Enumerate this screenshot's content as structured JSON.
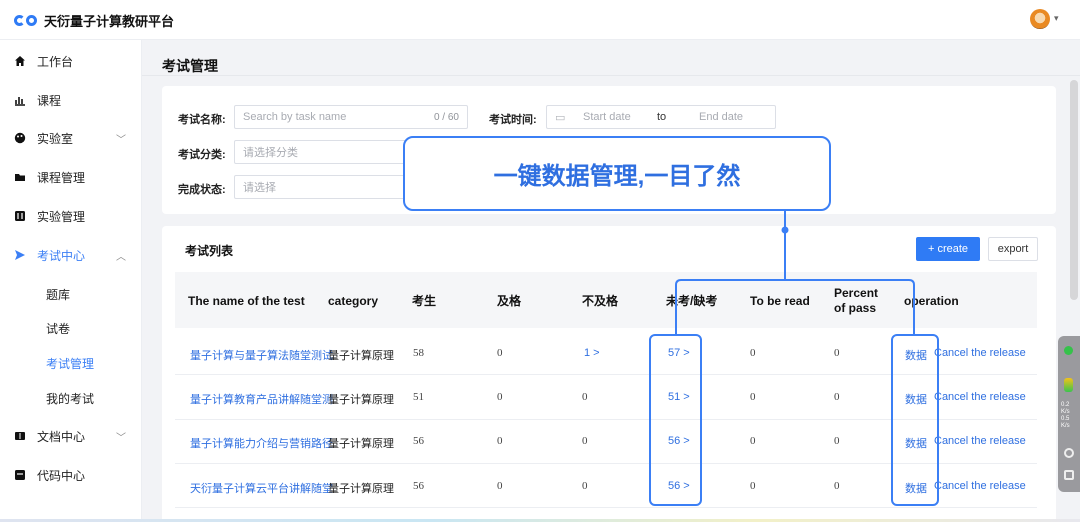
{
  "app": {
    "title": "天衍量子计算教研平台"
  },
  "sidebar": {
    "items": [
      {
        "label": "工作台",
        "icon": "home-icon"
      },
      {
        "label": "课程",
        "icon": "chart-icon"
      },
      {
        "label": "实验室",
        "icon": "palette-icon"
      },
      {
        "label": "课程管理",
        "icon": "folder-icon"
      },
      {
        "label": "实验管理",
        "icon": "grid-icon"
      },
      {
        "label": "考试中心",
        "icon": "send-icon"
      },
      {
        "label": "文档中心",
        "icon": "book-icon"
      },
      {
        "label": "代码中心",
        "icon": "code-icon"
      }
    ],
    "sub_items": [
      "题库",
      "试卷",
      "考试管理",
      "我的考试"
    ]
  },
  "page": {
    "title": "考试管理"
  },
  "filters": {
    "name_label": "考试名称:",
    "name_placeholder": "Search by task name",
    "name_count": "0 / 60",
    "time_label": "考试时间:",
    "start_placeholder": "Start date",
    "to": "to",
    "end_placeholder": "End date",
    "category_label": "考试分类:",
    "category_placeholder": "请选择分类",
    "status_label": "完成状态:",
    "status_placeholder": "请选择"
  },
  "callout": {
    "text": "一键数据管理,一目了然"
  },
  "list": {
    "title": "考试列表",
    "create_label": "+ create",
    "export_label": "export",
    "headers": [
      "The name of the test",
      "category",
      "考生",
      "及格",
      "不及格",
      "未考/缺考",
      "To be read",
      "Percent of pass",
      "operation"
    ],
    "rows": [
      {
        "name": "量子计算与量子算法随堂测试",
        "category": "量子计算原理",
        "examinees": "58",
        "pass": "0",
        "fail": "1 >",
        "absent": "57 >",
        "to_read": "0",
        "percent": "0",
        "data": "数据",
        "cancel": "Cancel the release"
      },
      {
        "name": "量子计算教育产品讲解随堂测",
        "category": "量子计算原理",
        "examinees": "51",
        "pass": "0",
        "fail": "0",
        "absent": "51 >",
        "to_read": "0",
        "percent": "0",
        "data": "数据",
        "cancel": "Cancel the release"
      },
      {
        "name": "量子计算能力介绍与营销路径",
        "category": "量子计算原理",
        "examinees": "56",
        "pass": "0",
        "fail": "0",
        "absent": "56 >",
        "to_read": "0",
        "percent": "0",
        "data": "数据",
        "cancel": "Cancel the release"
      },
      {
        "name": "天衍量子计算云平台讲解随堂",
        "category": "量子计算原理",
        "examinees": "56",
        "pass": "0",
        "fail": "0",
        "absent": "56 >",
        "to_read": "0",
        "percent": "0",
        "data": "数据",
        "cancel": "Cancel the release"
      }
    ]
  },
  "floater": {
    "speed_up": "0.2",
    "speed_down": "0.5",
    "unit": "K/s"
  },
  "colors": {
    "accent": "#2f7bf5",
    "link": "#2f6fe0"
  }
}
